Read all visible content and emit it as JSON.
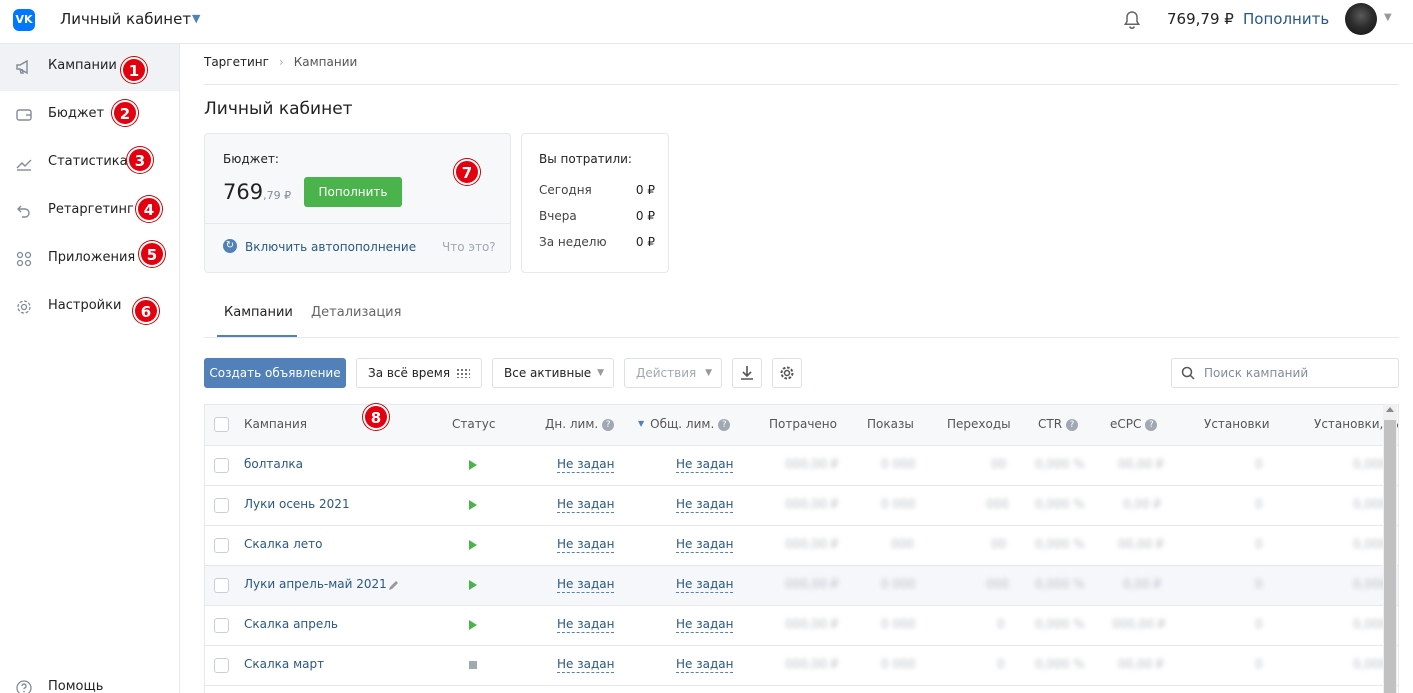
{
  "header": {
    "logo": "VK",
    "title": "Личный кабинет",
    "balance": "769,79 ₽",
    "topup_label": "Пополнить"
  },
  "sidebar": {
    "items": [
      {
        "label": "Кампании",
        "icon": "megaphone-icon",
        "badge": "1"
      },
      {
        "label": "Бюджет",
        "icon": "wallet-icon",
        "badge": "2"
      },
      {
        "label": "Статистика",
        "icon": "chart-icon",
        "badge": "3"
      },
      {
        "label": "Ретаргетинг",
        "icon": "retarget-arrow-icon",
        "badge": "4"
      },
      {
        "label": "Приложения",
        "icon": "apps-grid-icon",
        "badge": "5"
      },
      {
        "label": "Настройки",
        "icon": "gear-icon",
        "badge": "6"
      }
    ],
    "help_label": "Помощь"
  },
  "breadcrumb": {
    "parent": "Таргетинг",
    "current": "Кампании"
  },
  "page_title": "Личный кабинет",
  "budget": {
    "label": "Бюджет:",
    "value_int": "769",
    "value_frac": ",79 ₽",
    "topup_label": "Пополнить",
    "auto_label": "Включить автопополнение",
    "what_label": "Что это?",
    "badge": "7"
  },
  "spent": {
    "title": "Вы потратили:",
    "rows": [
      {
        "label": "Сегодня",
        "value": "0 ₽"
      },
      {
        "label": "Вчера",
        "value": "0 ₽"
      },
      {
        "label": "За неделю",
        "value": "0 ₽"
      }
    ]
  },
  "tabs": [
    {
      "label": "Кампании"
    },
    {
      "label": "Детализация"
    }
  ],
  "toolbar": {
    "create_label": "Создать объявление",
    "period_label": "За всё время",
    "filter_label": "Все активные",
    "actions_label": "Действия",
    "search_placeholder": "Поиск кампаний"
  },
  "table": {
    "badge": "8",
    "columns": [
      "Кампания",
      "Статус",
      "Дн. лим.",
      "Общ. лим.",
      "Потрачено",
      "Показы",
      "Переходы",
      "CTR",
      "eCPC",
      "Установки",
      "Установки, %"
    ],
    "unset_label": "Не задан",
    "rows": [
      {
        "name": "болталка",
        "status": "active"
      },
      {
        "name": "Луки осень 2021",
        "status": "active"
      },
      {
        "name": "Скалка лето",
        "status": "active"
      },
      {
        "name": "Луки апрель-май 2021",
        "status": "active"
      },
      {
        "name": "Скалка апрель",
        "status": "active"
      },
      {
        "name": "Скалка март",
        "status": "stopped"
      }
    ]
  },
  "colors": {
    "accent": "#5181b8",
    "green": "#4bb34b",
    "badge_red": "#e3010f",
    "link": "#2a5885"
  }
}
